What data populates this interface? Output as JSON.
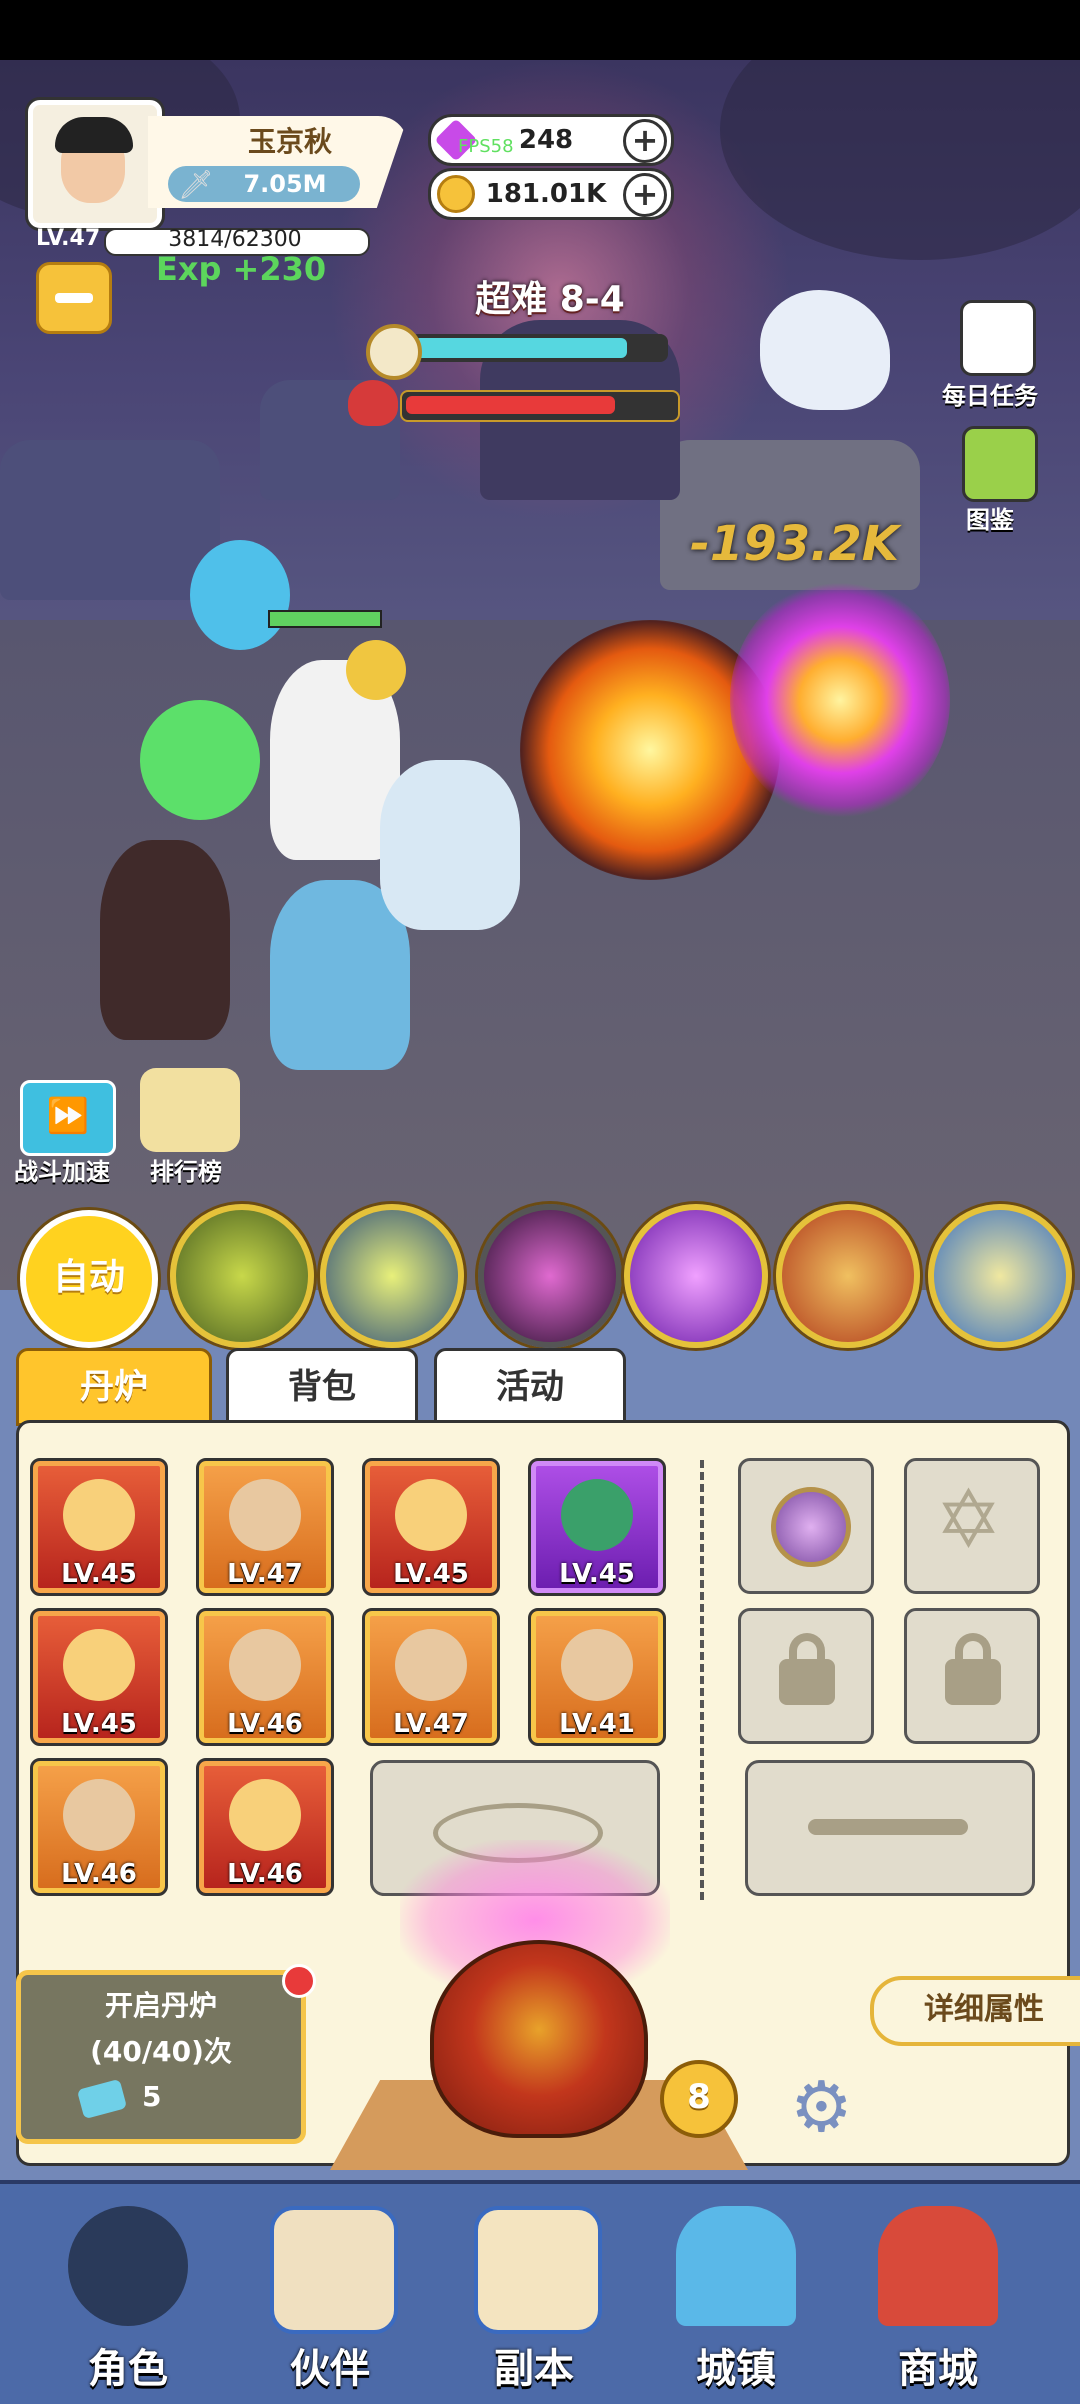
{
  "player": {
    "name": "玉京秋",
    "power": "7.05M",
    "level": "LV.47",
    "xp": "3814/62300",
    "exp_gain": "Exp +230"
  },
  "currency": {
    "gems": "248",
    "coins": "181.01K",
    "fps": "FPS58"
  },
  "stage": {
    "label": "超难 8-4",
    "timer_progress": 0.85,
    "boss_hp": 0.78
  },
  "damage_text": "-193.2K",
  "side": {
    "daily": "每日任务",
    "codex": "图鉴"
  },
  "scene_buttons": {
    "speed": "战斗加速",
    "rank": "排行榜"
  },
  "skills": {
    "auto": "自动"
  },
  "tabs": [
    "丹炉",
    "背包",
    "活动"
  ],
  "items": [
    {
      "lv": "LV.45",
      "rarity": "red",
      "icon": "spear-icon"
    },
    {
      "lv": "LV.47",
      "rarity": "orange",
      "icon": "scroll-icon"
    },
    {
      "lv": "LV.45",
      "rarity": "red",
      "icon": "helmet-icon"
    },
    {
      "lv": "LV.45",
      "rarity": "purple",
      "icon": "beast-orb-icon"
    },
    {
      "lv": "LV.45",
      "rarity": "red",
      "icon": "staff-icon"
    },
    {
      "lv": "LV.46",
      "rarity": "orange",
      "icon": "shield-icon"
    },
    {
      "lv": "LV.47",
      "rarity": "orange",
      "icon": "ring-icon"
    },
    {
      "lv": "LV.41",
      "rarity": "orange",
      "icon": "orb-icon"
    },
    {
      "lv": "LV.46",
      "rarity": "orange",
      "icon": "necklace-icon"
    },
    {
      "lv": "LV.46",
      "rarity": "red",
      "icon": "boots-icon"
    }
  ],
  "furnace": {
    "open_title": "开启丹炉",
    "open_count": "(40/40)次",
    "tickets": "5",
    "level": "8",
    "detail": "详细属性"
  },
  "nav": [
    "角色",
    "伙伴",
    "副本",
    "城镇",
    "商城"
  ]
}
